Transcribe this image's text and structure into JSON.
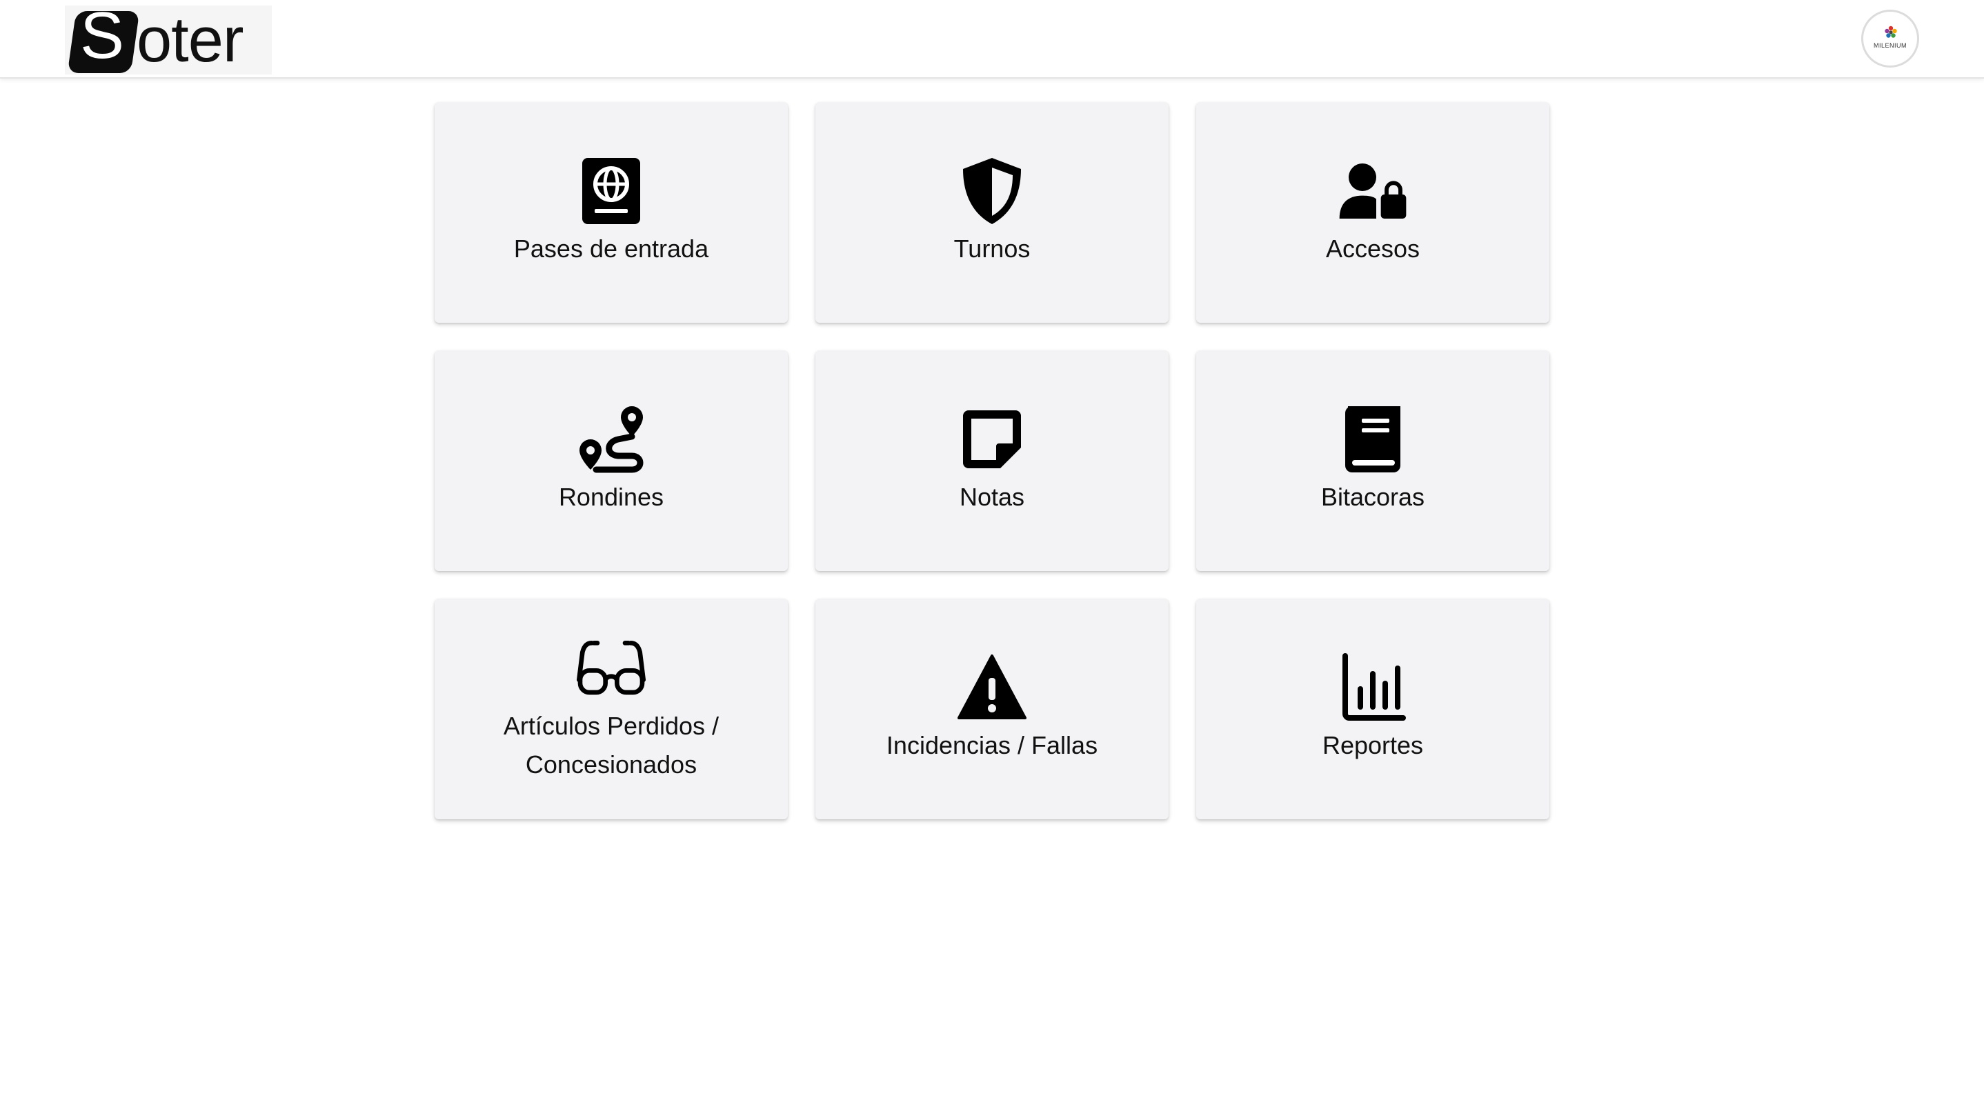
{
  "header": {
    "logo": {
      "initial": "S",
      "rest": "oter"
    },
    "avatar": {
      "text": "MILENIUM",
      "icon": "flower-logo-icon"
    }
  },
  "tiles": [
    {
      "label": "Pases de entrada",
      "icon": "passport-icon"
    },
    {
      "label": "Turnos",
      "icon": "shield-icon"
    },
    {
      "label": "Accesos",
      "icon": "user-lock-icon"
    },
    {
      "label": "Rondines",
      "icon": "route-icon"
    },
    {
      "label": "Notas",
      "icon": "sticky-note-icon"
    },
    {
      "label": "Bitacoras",
      "icon": "book-icon"
    },
    {
      "label": "Artículos Perdidos /\nConcesionados",
      "icon": "glasses-icon"
    },
    {
      "label": "Incidencias / Fallas",
      "icon": "warning-icon"
    },
    {
      "label": "Reportes",
      "icon": "bar-chart-icon"
    }
  ]
}
